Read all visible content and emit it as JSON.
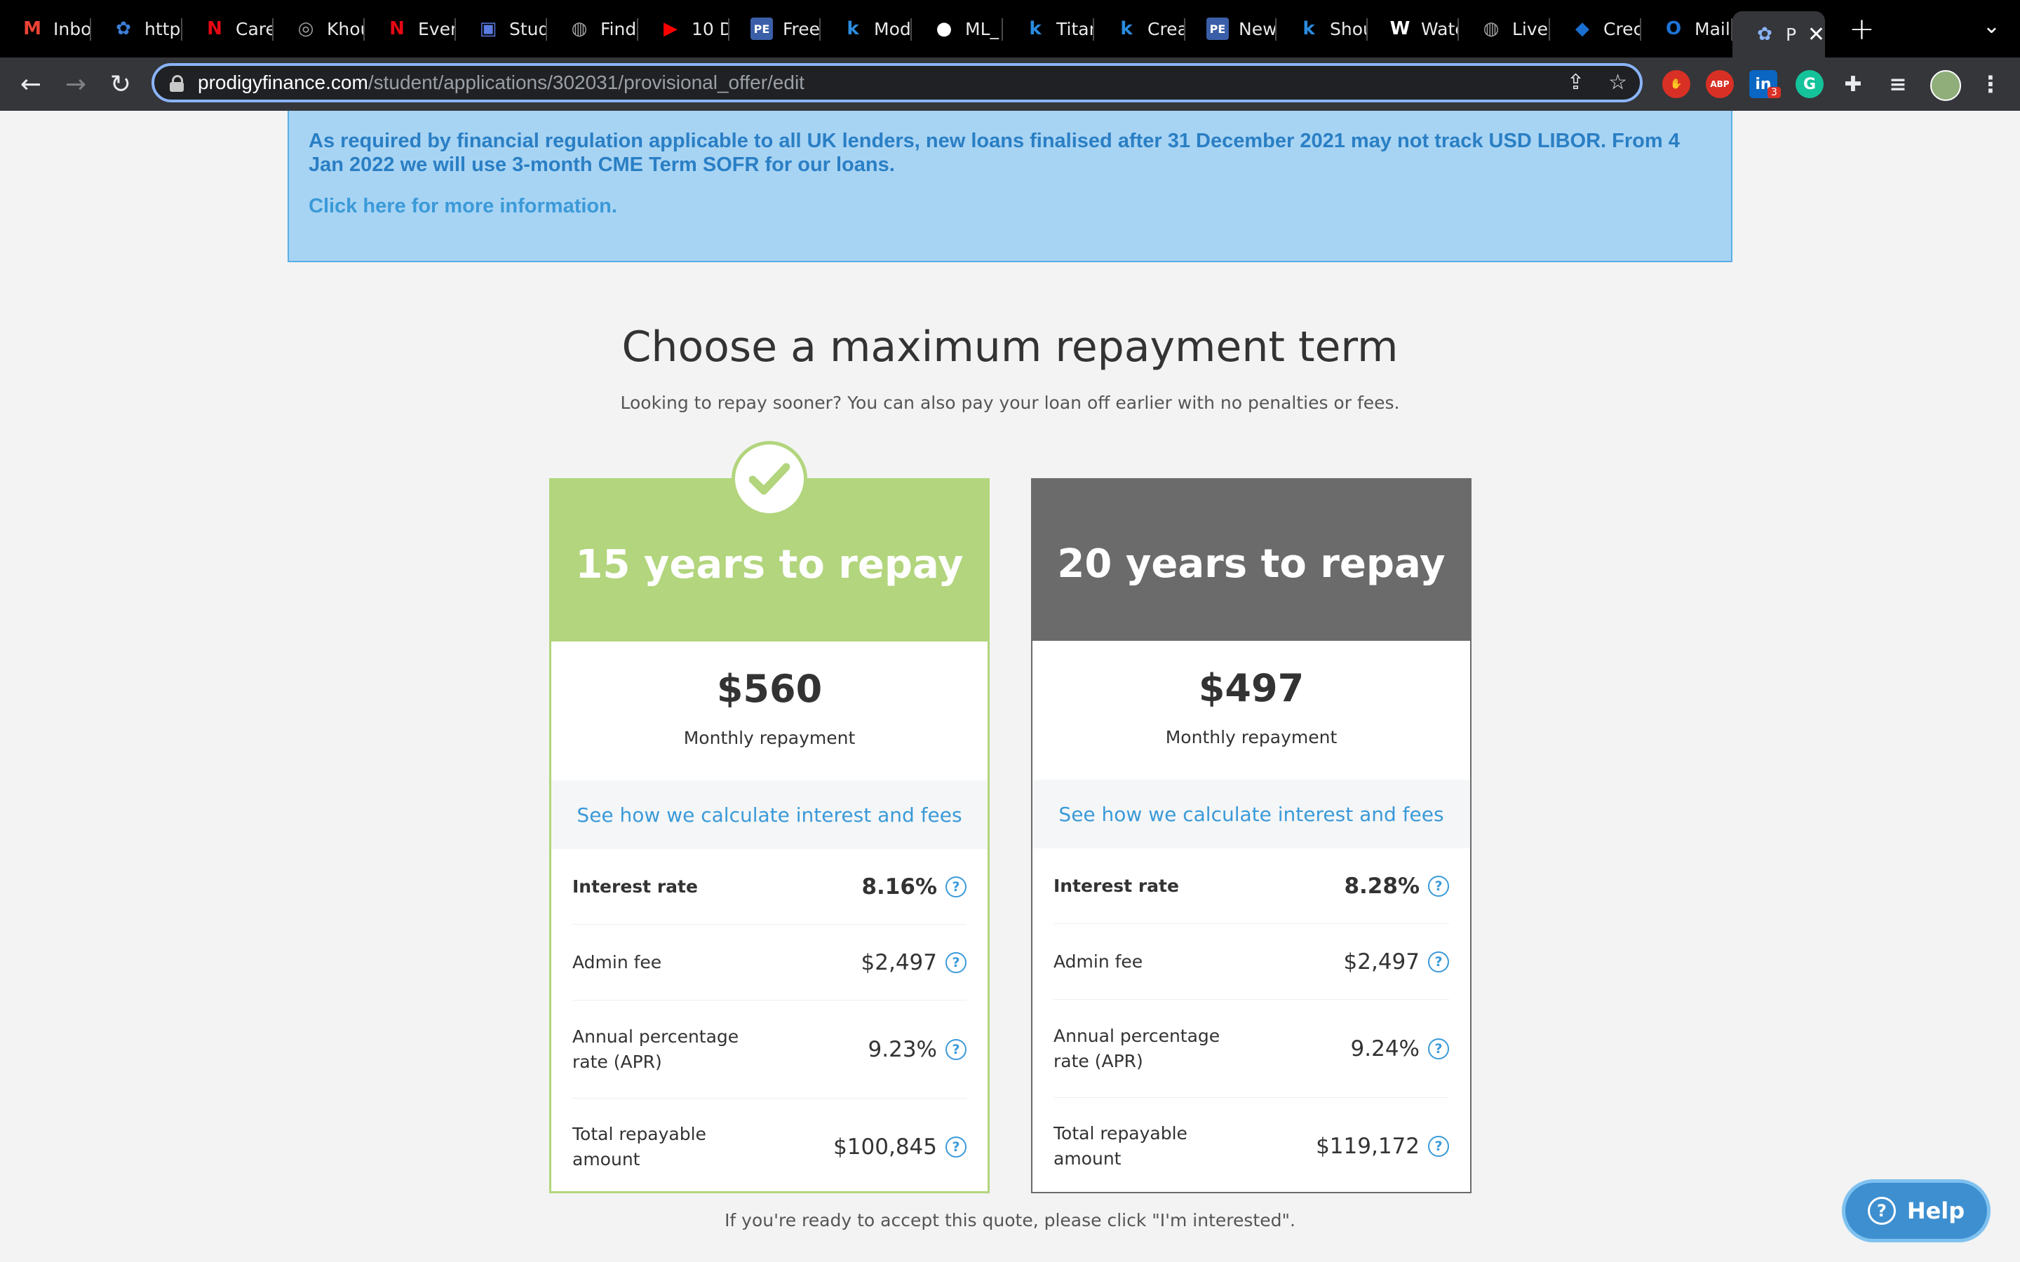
{
  "browser": {
    "tabs": [
      {
        "label": "Inbo",
        "icon": "gmail-icon",
        "color": "#ea4335",
        "glyph": "M"
      },
      {
        "label": "https",
        "icon": "lotus-icon",
        "color": "#3d7fd6",
        "glyph": "✿"
      },
      {
        "label": "Care",
        "icon": "netflix-icon",
        "color": "#e50914",
        "glyph": "N"
      },
      {
        "label": "Khou",
        "icon": "globe-icon",
        "color": "#a0a0a0",
        "glyph": "◎"
      },
      {
        "label": "Even",
        "icon": "netflix-icon",
        "color": "#e50914",
        "glyph": "N"
      },
      {
        "label": "Stud",
        "icon": "app-icon",
        "color": "#5a7be0",
        "glyph": "▣"
      },
      {
        "label": "Find",
        "icon": "globe-icon",
        "color": "#a0a0a0",
        "glyph": "◍"
      },
      {
        "label": "10 D",
        "icon": "youtube-icon",
        "color": "#ff0000",
        "glyph": "▶"
      },
      {
        "label": "Free",
        "icon": "pe-icon",
        "color": "#3b5ea8",
        "glyph": "PE"
      },
      {
        "label": "Mod",
        "icon": "k-icon",
        "color": "#2a8ce0",
        "glyph": "k"
      },
      {
        "label": "ML_",
        "icon": "github-icon",
        "color": "#ffffff",
        "glyph": "●"
      },
      {
        "label": "Titar",
        "icon": "k-icon",
        "color": "#2a8ce0",
        "glyph": "k"
      },
      {
        "label": "Crea",
        "icon": "k-icon",
        "color": "#2a8ce0",
        "glyph": "k"
      },
      {
        "label": "New",
        "icon": "pe-icon",
        "color": "#3b5ea8",
        "glyph": "PE"
      },
      {
        "label": "Shou",
        "icon": "k-icon",
        "color": "#2a8ce0",
        "glyph": "k"
      },
      {
        "label": "Watc",
        "icon": "wordpress-icon",
        "color": "#ffffff",
        "glyph": "W"
      },
      {
        "label": "Live",
        "icon": "globe-icon",
        "color": "#a0a0a0",
        "glyph": "◍"
      },
      {
        "label": "Crec",
        "icon": "chase-icon",
        "color": "#1a6fd1",
        "glyph": "◆"
      },
      {
        "label": "Mail",
        "icon": "outlook-icon",
        "color": "#1e73d6",
        "glyph": "O"
      }
    ],
    "active_tab": {
      "label": "P",
      "glyph": "✿"
    },
    "new_tab": "+",
    "url_host": "prodigyfinance.com",
    "url_path": "/student/applications/302031/provisional_offer/edit",
    "extensions": [
      {
        "name": "adblock-icon",
        "label": "",
        "color": "#d93025"
      },
      {
        "name": "abp-icon",
        "label": "ABP",
        "color": "#d93025"
      },
      {
        "name": "linkedin-icon",
        "label": "in",
        "color": "#0a66c2"
      },
      {
        "name": "grammarly-icon",
        "label": "G",
        "color": "#15c39a"
      }
    ],
    "linkedin_badge": "3"
  },
  "notice": {
    "text": "As required by financial regulation applicable to all UK lenders, new loans finalised after 31 December 2021 may not track USD LIBOR. From 4 Jan 2022 we will use 3-month CME Term SOFR for our loans.",
    "link": "Click here for more information."
  },
  "heading": "Choose a maximum repayment term",
  "subheading": "Looking to repay sooner? You can also pay your loan off earlier with no penalties or fees.",
  "cards": [
    {
      "title": "15 years to repay",
      "selected": true,
      "monthly_amount": "$560",
      "monthly_label": "Monthly repayment",
      "calc_link": "See how we calculate interest and fees",
      "interest_label": "Interest rate",
      "interest_value": "8.16%",
      "admin_label": "Admin fee",
      "admin_value": "$2,497",
      "apr_label": "Annual percentage rate (APR)",
      "apr_value": "9.23%",
      "total_label": "Total repayable amount",
      "total_value": "$100,845"
    },
    {
      "title": "20 years to repay",
      "selected": false,
      "monthly_amount": "$497",
      "monthly_label": "Monthly repayment",
      "calc_link": "See how we calculate interest and fees",
      "interest_label": "Interest rate",
      "interest_value": "8.28%",
      "admin_label": "Admin fee",
      "admin_value": "$2,497",
      "apr_label": "Annual percentage rate (APR)",
      "apr_value": "9.24%",
      "total_label": "Total repayable amount",
      "total_value": "$119,172"
    }
  ],
  "question_mark": "?",
  "footer_note": "If you're ready to accept this quote, please click \"I'm interested\".",
  "help_label": "Help",
  "colors": {
    "selected_green": "#b2d57d",
    "unselected_gray": "#6b6b6b",
    "link_blue": "#3a9ad9",
    "notice_bg": "#a8d4f4"
  }
}
